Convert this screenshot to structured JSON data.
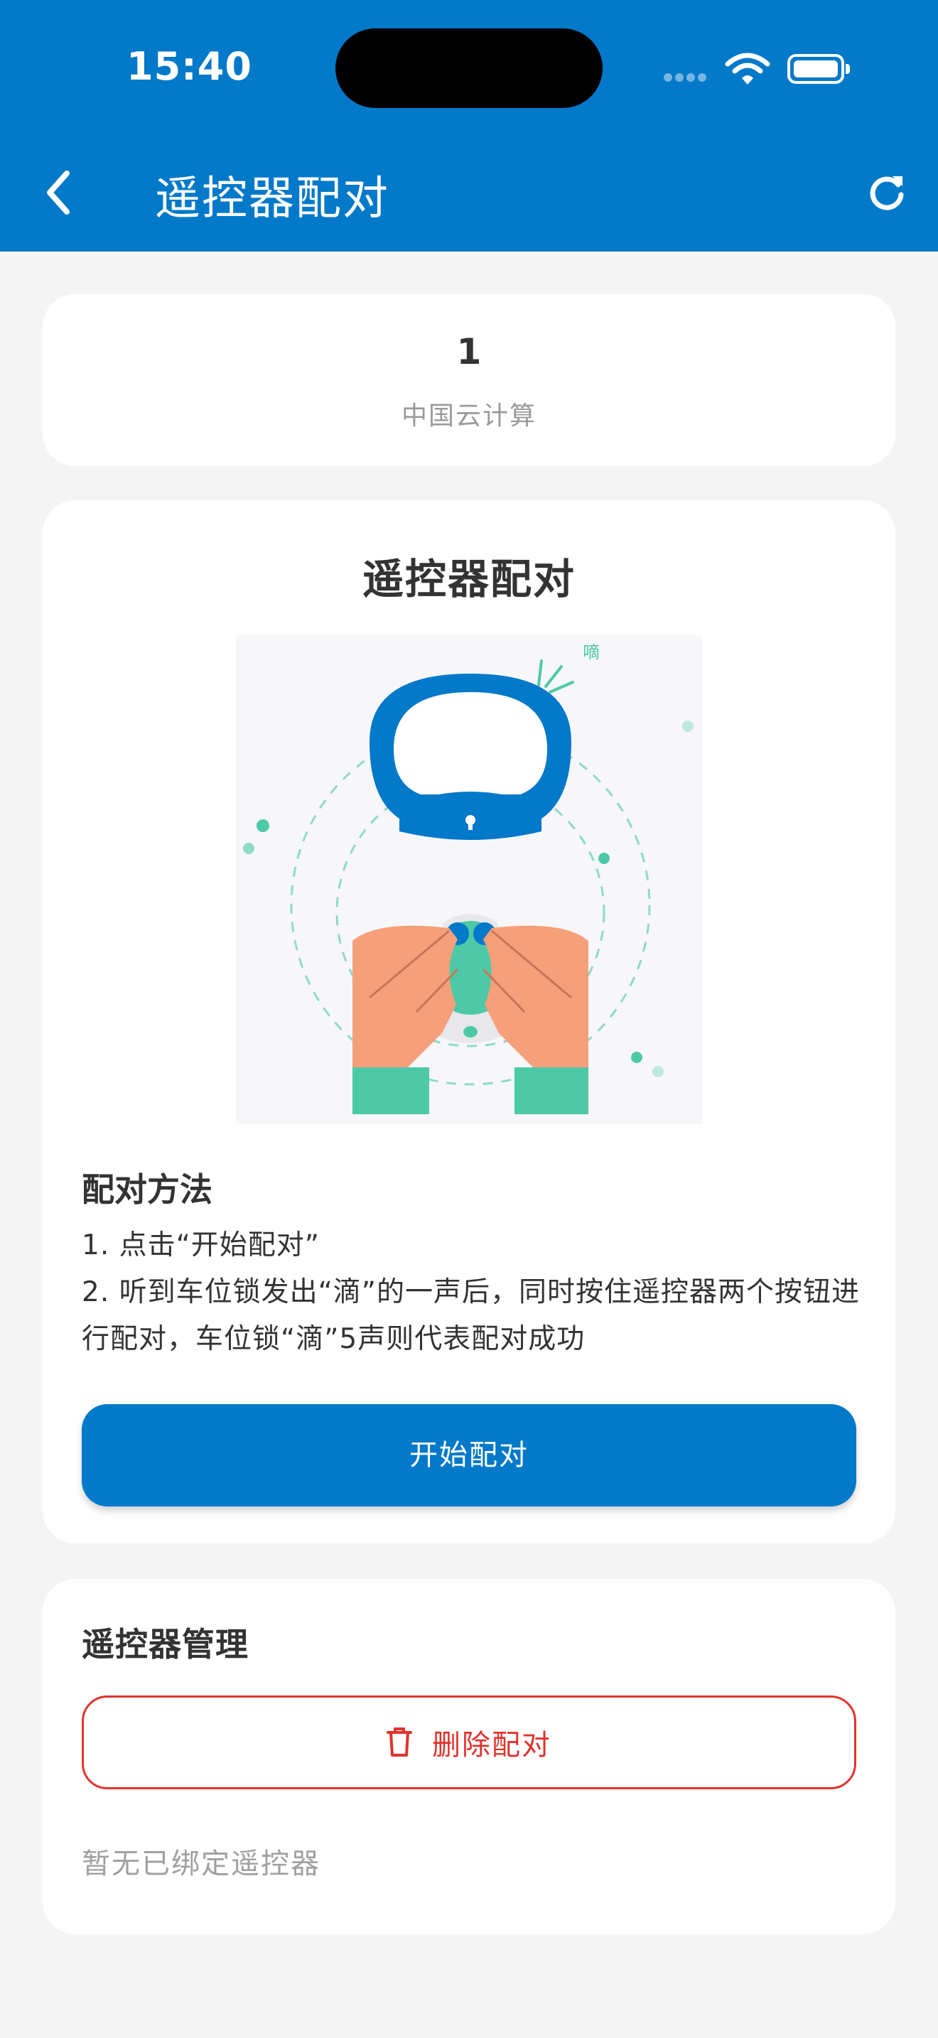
{
  "status_bar": {
    "time": "15:40"
  },
  "nav": {
    "title": "遥控器配对"
  },
  "info_card": {
    "number": "1",
    "organization": "中国云计算"
  },
  "pairing": {
    "title": "遥控器配对",
    "illustration_sound_text": "嘀",
    "method_title": "配对方法",
    "steps": [
      "1. 点击“开始配对”",
      "2. 听到车位锁发出“滴”的一声后，同时按住遥控器两个按钮进行配对，车位锁“滴”5声则代表配对成功"
    ],
    "start_button": "开始配对"
  },
  "management": {
    "title": "遥控器管理",
    "delete_button": "删除配对",
    "empty_text": "暂无已绑定遥控器"
  },
  "colors": {
    "primary": "#0279c9",
    "danger": "#e2322c",
    "teal": "#4dc9a7",
    "skin": "#f5a07a"
  }
}
